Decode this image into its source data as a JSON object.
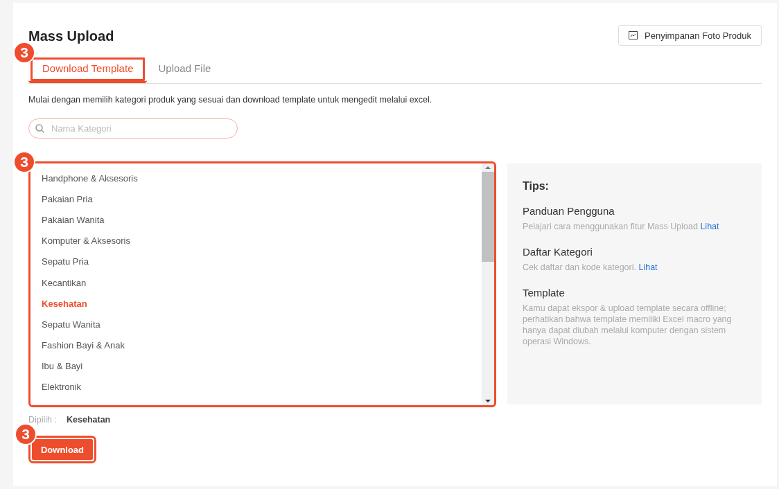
{
  "title": "Mass Upload",
  "photo_storage_button": {
    "label": "Penyimpanan Foto Produk"
  },
  "tabs": [
    {
      "label": "Download Template",
      "selected": true
    },
    {
      "label": "Upload File",
      "selected": false
    }
  ],
  "tabs_callout": "3",
  "description": "Mulai dengan memilih kategori produk yang sesuai dan download template untuk mengedit melalui excel.",
  "search": {
    "placeholder": "Nama Kategori"
  },
  "category_list": {
    "callout": "3",
    "items": [
      {
        "label": "Handphone & Aksesoris",
        "selected": false
      },
      {
        "label": "Pakaian Pria",
        "selected": false
      },
      {
        "label": "Pakaian Wanita",
        "selected": false
      },
      {
        "label": "Komputer & Aksesoris",
        "selected": false
      },
      {
        "label": "Sepatu Pria",
        "selected": false
      },
      {
        "label": "Kecantikan",
        "selected": false
      },
      {
        "label": "Kesehatan",
        "selected": true
      },
      {
        "label": "Sepatu Wanita",
        "selected": false
      },
      {
        "label": "Fashion Bayi & Anak",
        "selected": false
      },
      {
        "label": "Ibu & Bayi",
        "selected": false
      },
      {
        "label": "Elektronik",
        "selected": false
      }
    ]
  },
  "tips": {
    "title": "Tips:",
    "sections": [
      {
        "heading": "Panduan Pengguna",
        "text": "Pelajari cara menggunakan fitur Mass Upload",
        "link": "Lihat"
      },
      {
        "heading": "Daftar Kategori",
        "text": "Cek daftar dan kode kategori.",
        "link": "Lihat"
      },
      {
        "heading": "Template",
        "text": "Kamu dapat ekspor & upload template secara offline; perhatikan bahwa template memiliki Excel macro yang hanya dapat diubah melalui komputer dengan sistem operasi Windows."
      }
    ]
  },
  "selection": {
    "label": "Dipilih :",
    "value": "Kesehatan"
  },
  "download_button": {
    "label": "Download",
    "callout": "3"
  }
}
